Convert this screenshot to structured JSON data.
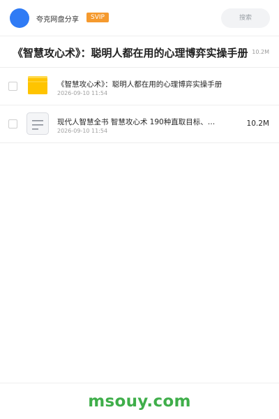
{
  "header": {
    "brand": "夸克网盘分享",
    "svip": "SVIP",
    "search_placeholder": "搜索"
  },
  "share": {
    "title": "《智慧攻心术》：聪明人都在用的心理博弈实操手册",
    "size": "10.2M"
  },
  "files": [
    {
      "name": "《智慧攻心术》：聪明人都在用的心理博弈实操手册",
      "date": "2026-09-10 11:54",
      "size": "",
      "icon": "folder-icon"
    },
    {
      "name": "现代人智慧全书 智慧攻心术 190种直取目标、…",
      "date": "2026-09-10 11:54",
      "size": "10.2M",
      "icon": "document-icon"
    }
  ],
  "footer": {
    "watermark": "msouy.com"
  },
  "colors": {
    "brand_blue": "#2f7bf5",
    "svip_orange": "#f59a2e",
    "folder_yellow": "#ffc400",
    "watermark_green": "#3fae4a"
  }
}
